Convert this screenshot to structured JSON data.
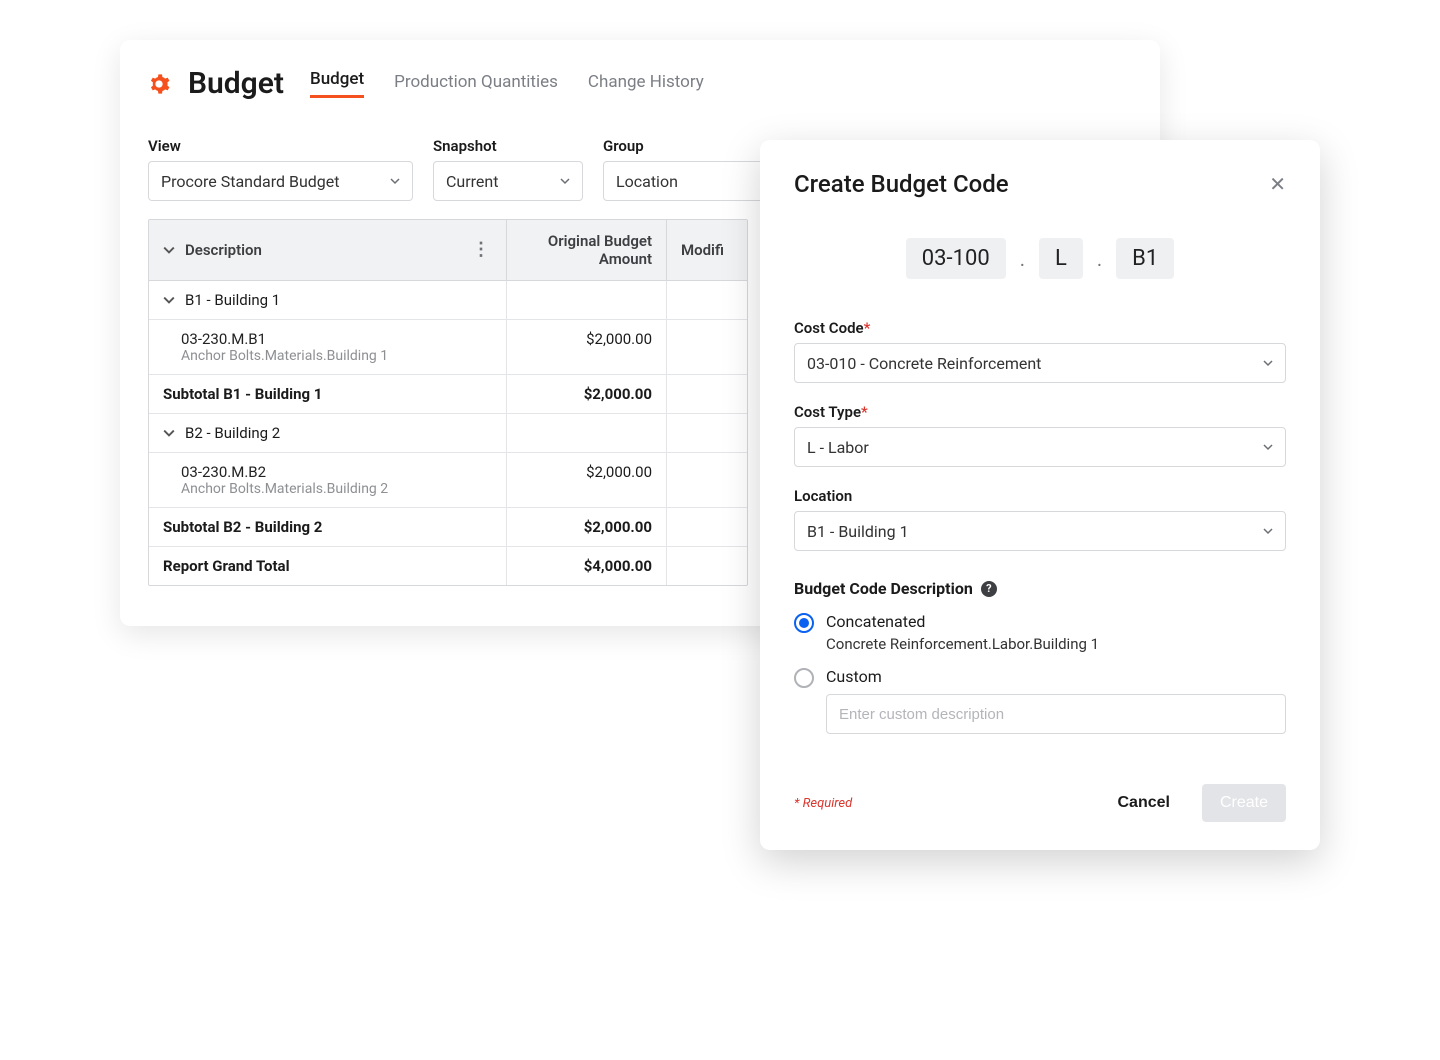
{
  "header": {
    "page_title": "Budget",
    "tabs": [
      {
        "label": "Budget",
        "active": true
      },
      {
        "label": "Production Quantities",
        "active": false
      },
      {
        "label": "Change History",
        "active": false
      }
    ]
  },
  "filters": {
    "view_label": "View",
    "view_value": "Procore Standard Budget",
    "snapshot_label": "Snapshot",
    "snapshot_value": "Current",
    "group_label": "Group",
    "group_value": "Location"
  },
  "table": {
    "columns": {
      "description": "Description",
      "original_amount": "Original Budget Amount",
      "modifi": "Modifi"
    },
    "groups": [
      {
        "header": "B1 - Building 1",
        "items": [
          {
            "code": "03-230.M.B1",
            "desc": "Anchor Bolts.Materials.Building 1",
            "amount": "$2,000.00"
          }
        ],
        "subtotal_label": "Subtotal B1 - Building 1",
        "subtotal_amount": "$2,000.00"
      },
      {
        "header": "B2 - Building 2",
        "items": [
          {
            "code": "03-230.M.B2",
            "desc": "Anchor Bolts.Materials.Building 2",
            "amount": "$2,000.00"
          }
        ],
        "subtotal_label": "Subtotal B2 - Building 2",
        "subtotal_amount": "$2,000.00"
      }
    ],
    "grand_total_label": "Report Grand Total",
    "grand_total_amount": "$4,000.00"
  },
  "modal": {
    "title": "Create Budget Code",
    "preview": {
      "seg1": "03-100",
      "seg2": "L",
      "seg3": "B1"
    },
    "cost_code_label": "Cost Code",
    "cost_code_value": "03-010 - Concrete Reinforcement",
    "cost_type_label": "Cost Type",
    "cost_type_value": "L - Labor",
    "location_label": "Location",
    "location_value": "B1 - Building 1",
    "desc_section_label": "Budget Code Description",
    "radio_concat_label": "Concatenated",
    "concat_preview": "Concrete Reinforcement.Labor.Building 1",
    "radio_custom_label": "Custom",
    "custom_placeholder": "Enter custom description",
    "required_note": "* Required",
    "cancel_label": "Cancel",
    "create_label": "Create"
  }
}
